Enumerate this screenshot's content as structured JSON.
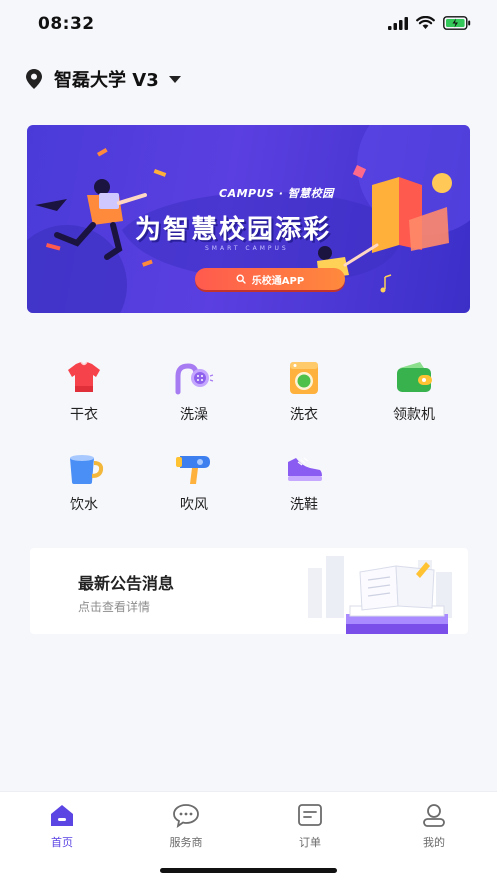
{
  "status_bar": {
    "time": "08:32"
  },
  "header": {
    "location_title": "智磊大学 V3"
  },
  "banner": {
    "campus_text": "CAMPUS · 智慧校园",
    "slogan": "为智慧校园添彩",
    "sub_text": "SMART CAMPUS",
    "button_label": "乐校通APP"
  },
  "services": [
    {
      "label": "干衣",
      "icon": "shirt-icon"
    },
    {
      "label": "洗澡",
      "icon": "shower-icon"
    },
    {
      "label": "洗衣",
      "icon": "washing-machine-icon"
    },
    {
      "label": "领款机",
      "icon": "wallet-icon"
    },
    {
      "label": "饮水",
      "icon": "cup-icon"
    },
    {
      "label": "吹风",
      "icon": "hair-dryer-icon"
    },
    {
      "label": "洗鞋",
      "icon": "shoe-icon"
    }
  ],
  "notice": {
    "title": "最新公告消息",
    "subtitle": "点击查看详情"
  },
  "tabbar": {
    "items": [
      {
        "label": "首页",
        "icon": "home-icon",
        "active": true
      },
      {
        "label": "服务商",
        "icon": "chat-bubble-icon",
        "active": false
      },
      {
        "label": "订单",
        "icon": "order-icon",
        "active": false
      },
      {
        "label": "我的",
        "icon": "profile-icon",
        "active": false
      }
    ]
  },
  "colors": {
    "accent": "#5b45e3",
    "banner_bg": "#4a3bd8",
    "button_orange": "#ff6a45"
  }
}
